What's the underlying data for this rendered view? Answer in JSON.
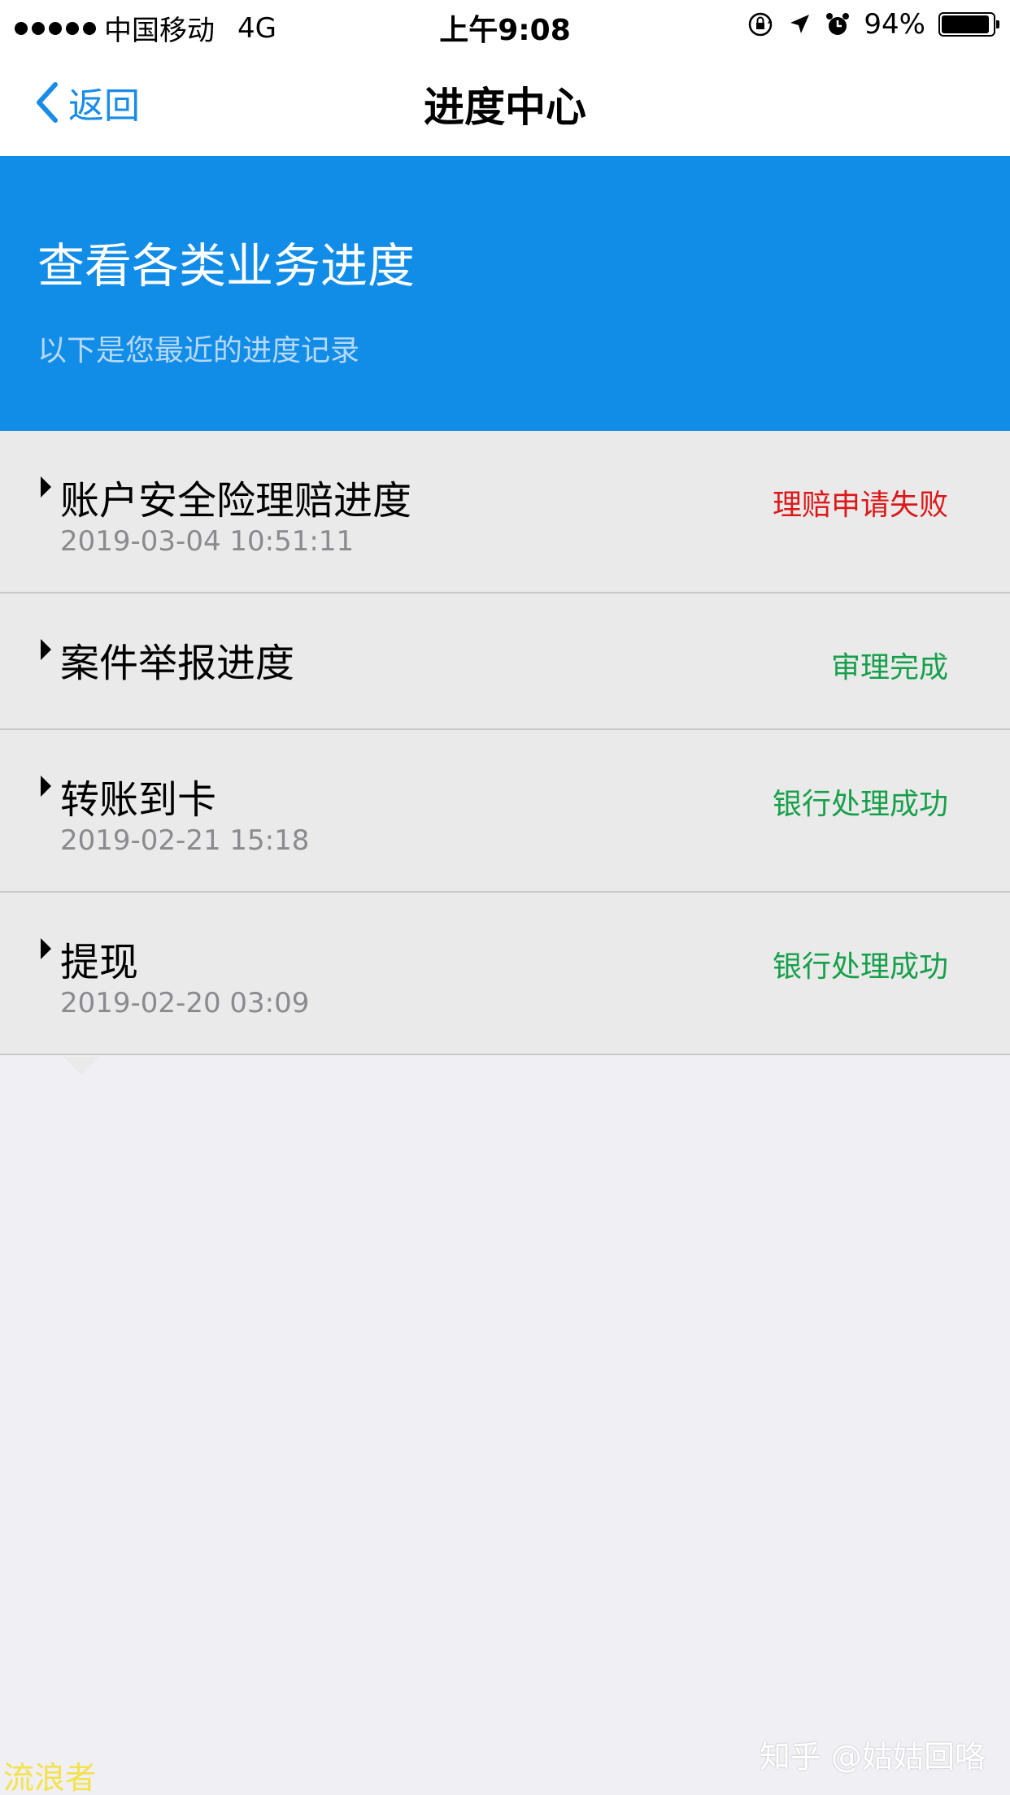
{
  "status_bar": {
    "carrier": "中国移动",
    "network": "4G",
    "time": "上午9:08",
    "battery": "94%",
    "battery_level": 0.94
  },
  "nav": {
    "back_label": "返回",
    "title": "进度中心"
  },
  "banner": {
    "title": "查看各类业务进度",
    "subtitle": "以下是您最近的进度记录"
  },
  "items": [
    {
      "title": "账户安全险理赔进度",
      "time": "2019-03-04 10:51:11",
      "status": "理赔申请失败"
    },
    {
      "title": "案件举报进度",
      "time": "",
      "status": "审理完成"
    },
    {
      "title": "转账到卡",
      "time": "2019-02-21 15:18",
      "status": "银行处理成功"
    },
    {
      "title": "提现",
      "time": "2019-02-20 03:09",
      "status": "银行处理成功"
    }
  ],
  "colors": {
    "accent": "#1a8ce6",
    "banner": "#118de8",
    "fail": "#dd1818",
    "success": "#16a04a"
  },
  "watermarks": {
    "right": "知乎 @姑姑回咯",
    "left": "流浪者"
  }
}
